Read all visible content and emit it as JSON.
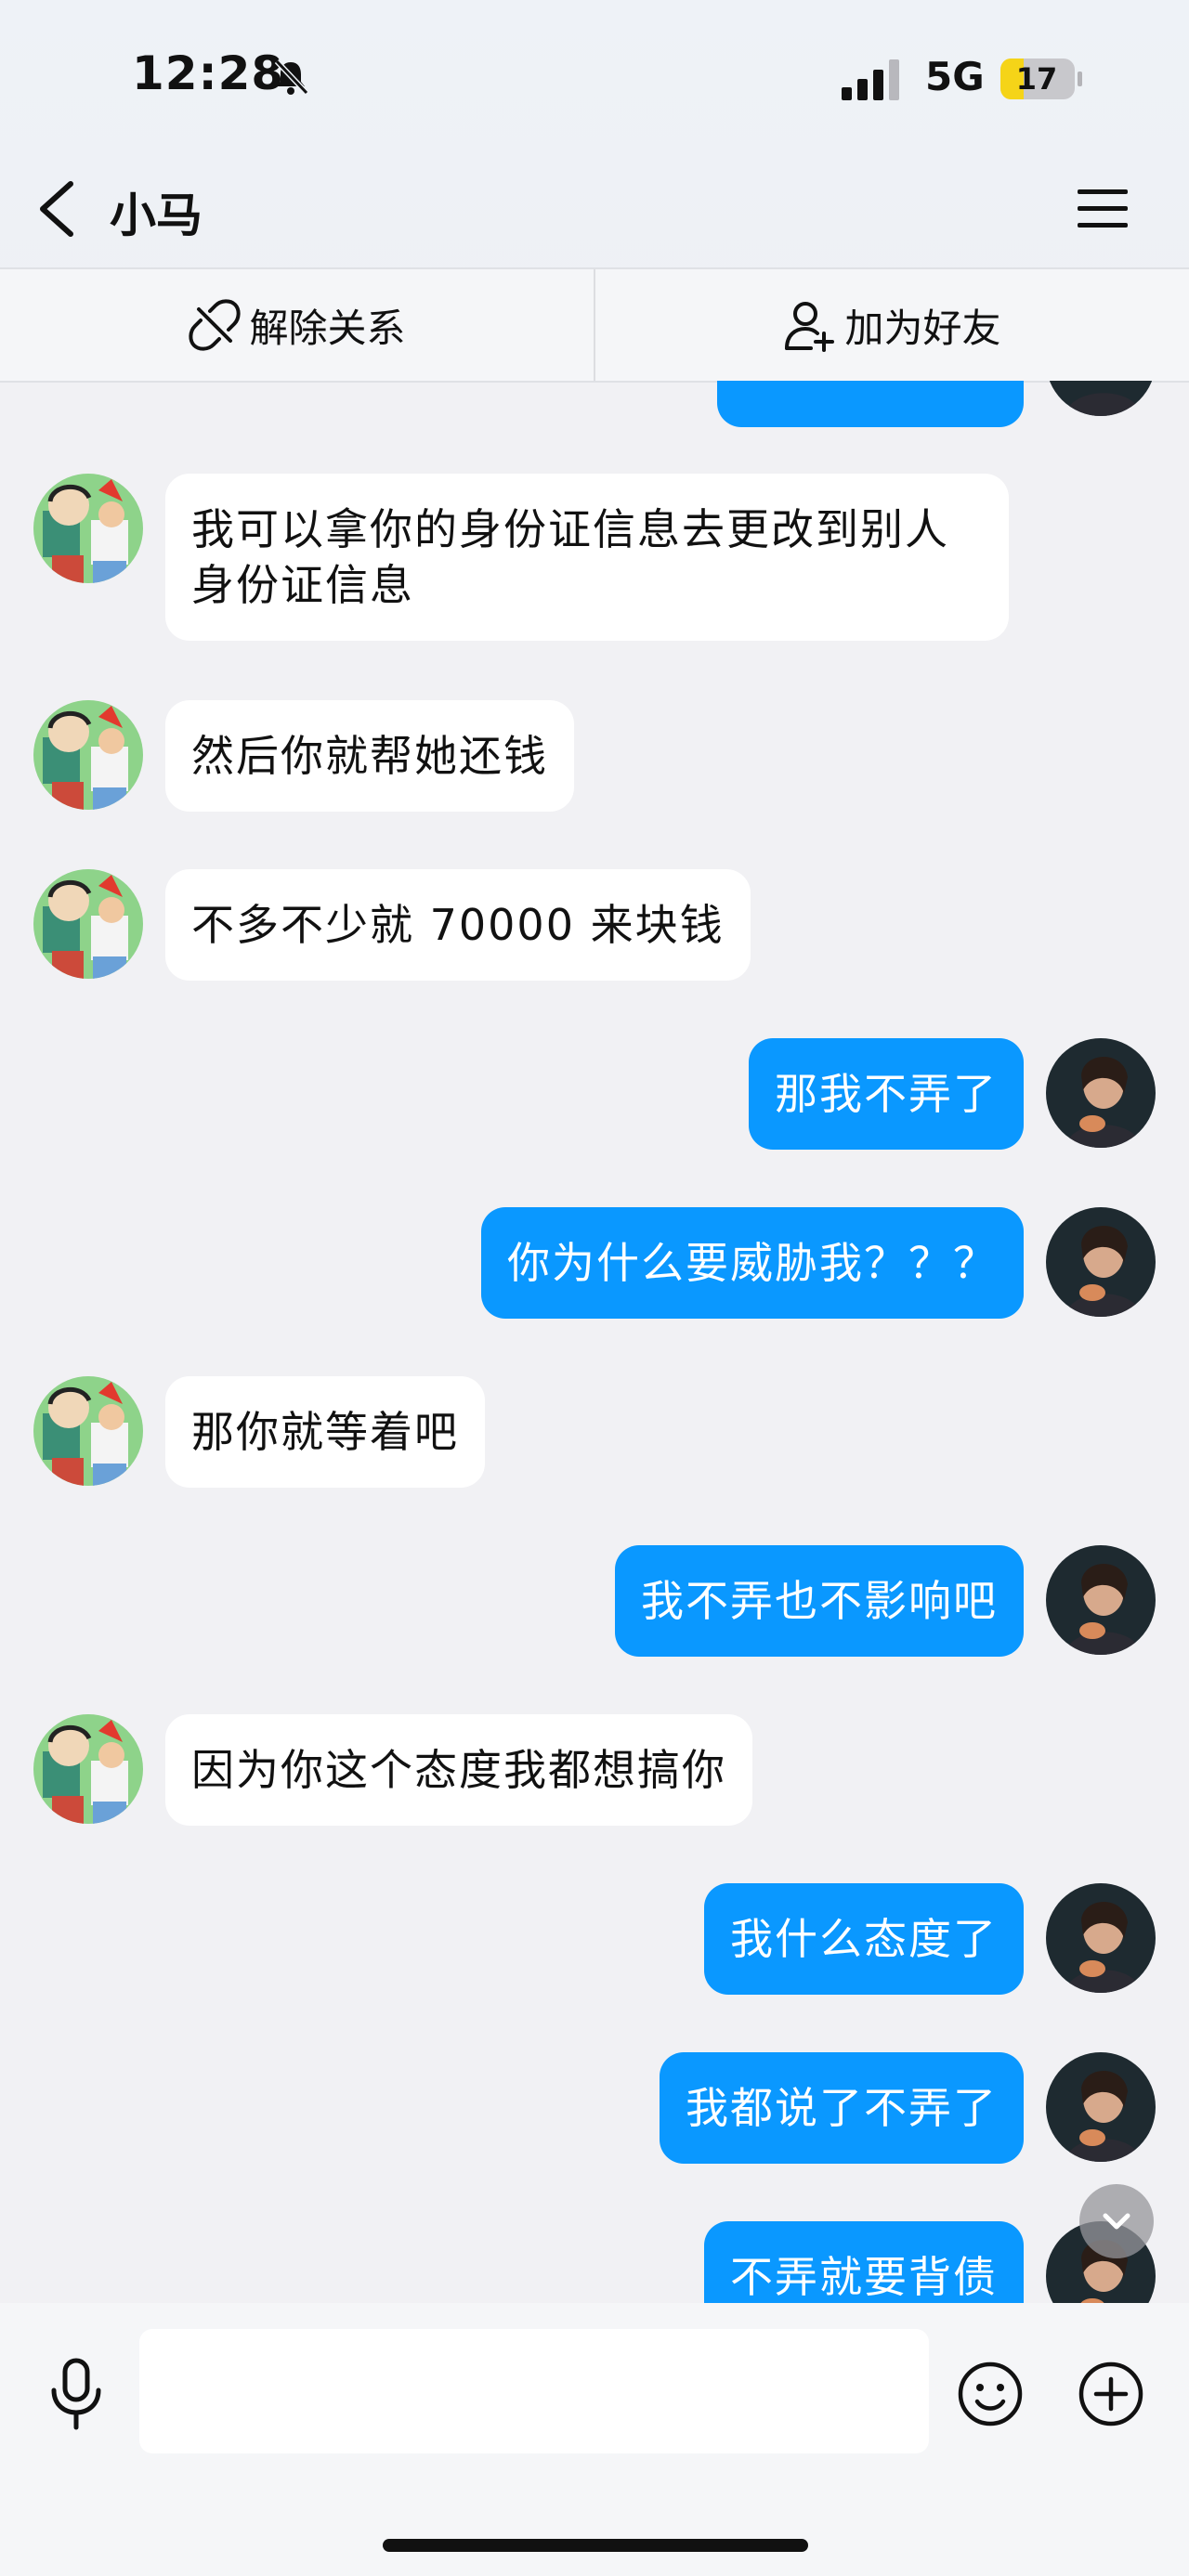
{
  "status_bar": {
    "time": "12:28",
    "network": "5G",
    "battery": "17"
  },
  "nav": {
    "title": "小马"
  },
  "actions": {
    "unlink_label": "解除关系",
    "add_friend_label": "加为好友"
  },
  "colors": {
    "sent_bubble": "#0a98ff",
    "received_bubble": "#ffffff",
    "background": "#f1f1f4"
  },
  "messages": [
    {
      "side": "left",
      "text": "我可以拿你的身份证信息去更改到别人身份证信息"
    },
    {
      "side": "left",
      "text": "然后你就帮她还钱"
    },
    {
      "side": "left",
      "text": "不多不少就 70000 来块钱"
    },
    {
      "side": "right",
      "text": "那我不弄了"
    },
    {
      "side": "right",
      "text": "你为什么要威胁我？？？"
    },
    {
      "side": "left",
      "text": "那你就等着吧"
    },
    {
      "side": "right",
      "text": "我不弄也不影响吧"
    },
    {
      "side": "left",
      "text": "因为你这个态度我都想搞你"
    },
    {
      "side": "right",
      "text": "我什么态度了"
    },
    {
      "side": "right",
      "text": "我都说了不弄了"
    },
    {
      "side": "right",
      "text": "不弄就要背债"
    }
  ],
  "icons": {
    "back": "chevron-left-icon",
    "menu": "hamburger-menu-icon",
    "unlink": "unlink-icon",
    "add_friend": "add-user-icon",
    "mic": "microphone-icon",
    "emoji": "emoji-icon",
    "plus": "plus-circle-icon",
    "scroll": "chevron-down-icon"
  },
  "input": {
    "value": ""
  }
}
